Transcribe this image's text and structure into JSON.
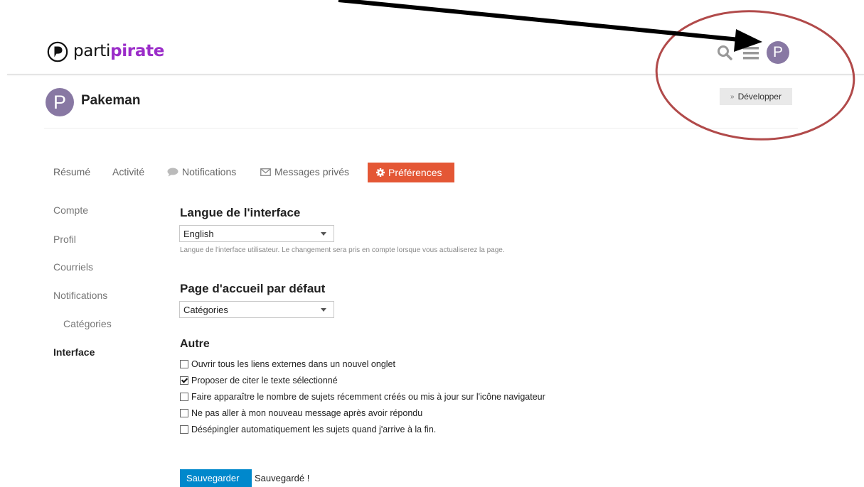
{
  "header": {
    "logo_prefix": "parti",
    "logo_suffix": "pirate",
    "user_initial": "P"
  },
  "user": {
    "initial": "P",
    "name": "Pakeman",
    "expand_label": "Développer"
  },
  "tabs": [
    {
      "label": "Résumé",
      "active": false
    },
    {
      "label": "Activité",
      "active": false
    },
    {
      "label": "Notifications",
      "icon": "speech-bubble-icon",
      "active": false
    },
    {
      "label": "Messages privés",
      "icon": "envelope-icon",
      "active": false
    },
    {
      "label": "Préférences",
      "icon": "gear-icon",
      "active": true
    }
  ],
  "sidebar": {
    "items": [
      {
        "label": "Compte"
      },
      {
        "label": "Profil"
      },
      {
        "label": "Courriels"
      },
      {
        "label": "Notifications"
      },
      {
        "label": "Catégories"
      },
      {
        "label": "Interface",
        "active": true
      }
    ]
  },
  "interface_language": {
    "title": "Langue de l'interface",
    "value": "English",
    "hint": "Langue de l'interface utilisateur. Le changement sera pris en compte lorsque vous actualiserez la page."
  },
  "default_home": {
    "title": "Page d'accueil par défaut",
    "value": "Catégories"
  },
  "other": {
    "title": "Autre",
    "options": [
      {
        "label": "Ouvrir tous les liens externes dans un nouvel onglet",
        "checked": false
      },
      {
        "label": "Proposer de citer le texte sélectionné",
        "checked": true
      },
      {
        "label": "Faire apparaître le nombre de sujets récemment créés ou mis à jour sur l'icône navigateur",
        "checked": false
      },
      {
        "label": "Ne pas aller à mon nouveau message après avoir répondu",
        "checked": false
      },
      {
        "label": "Désépingler automatiquement les sujets quand j'arrive à la fin.",
        "checked": false
      }
    ]
  },
  "actions": {
    "save_label": "Sauvegarder",
    "saved_label": "Sauvegardé !"
  },
  "colors": {
    "accent_active_tab": "#e45735",
    "save_button": "#0088cc",
    "logo_brand": "#9b2dc9",
    "avatar": "#8878a3",
    "annotation_ellipse": "#b14a4a",
    "annotation_arrow": "#000000"
  }
}
